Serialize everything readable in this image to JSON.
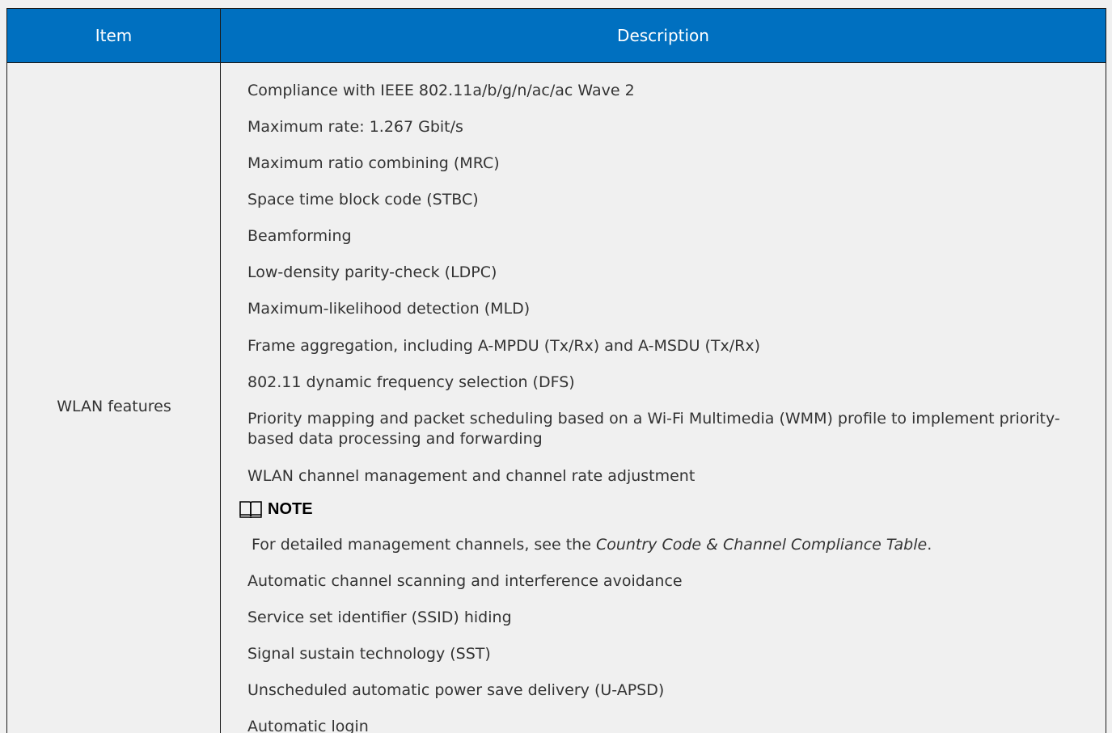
{
  "table": {
    "header": {
      "item": "Item",
      "description": "Description"
    },
    "row": {
      "item": "WLAN features",
      "features_before_note": [
        "Compliance with IEEE 802.11a/b/g/n/ac/ac Wave 2",
        "Maximum rate: 1.267 Gbit/s",
        "Maximum ratio combining (MRC)",
        "Space time block code (STBC)",
        "Beamforming",
        "Low-density parity-check (LDPC)",
        "Maximum-likelihood detection (MLD)",
        "Frame aggregation, including A-MPDU (Tx/Rx) and A-MSDU (Tx/Rx)",
        "802.11 dynamic frequency selection (DFS)",
        "Priority mapping and packet scheduling based on a Wi-Fi Multimedia (WMM) profile to implement priority-based data processing and forwarding",
        "WLAN channel management and channel rate adjustment"
      ],
      "note": {
        "title": "NOTE",
        "text_prefix": "For detailed management channels, see the ",
        "reference": "Country Code & Channel Compliance Table",
        "text_suffix": "."
      },
      "features_after_note": [
        "Automatic channel scanning and interference avoidance",
        "Service set identifier (SSID) hiding",
        "Signal sustain technology (SST)",
        "Unscheduled automatic power save delivery (U-APSD)",
        "Automatic login"
      ]
    }
  },
  "colors": {
    "header_bg": "#0070c0",
    "header_text": "#ffffff",
    "page_bg": "#f0f0f0",
    "body_text": "#333333",
    "border": "#1a1a1a"
  },
  "icons": {
    "note": "open-book-icon"
  }
}
